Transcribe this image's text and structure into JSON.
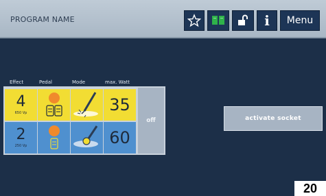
{
  "header": {
    "program_name": "PROGRAM NAME",
    "info_label": "i",
    "menu_label": "Menu",
    "icons": [
      "star-icon",
      "book-icon",
      "unlock-icon",
      "info-icon"
    ]
  },
  "columns": {
    "effect": "Effect",
    "pedal": "Pedal",
    "mode": "Mode",
    "max_watt": "max. Watt"
  },
  "channels": [
    {
      "effect": "4",
      "effect_sub": "650 Vp",
      "pedal_icon": "double-pedal-icon",
      "mode_icon": "cut-instrument-icon",
      "max_watt": "35",
      "color": "#f2dd33"
    },
    {
      "effect": "2",
      "effect_sub": "250 Vp",
      "pedal_icon": "single-pedal-icon",
      "mode_icon": "coag-instrument-icon",
      "max_watt": "60",
      "color": "#4f90cf"
    }
  ],
  "off_label": "off",
  "activate_label": "activate socket",
  "page_number": "20",
  "colors": {
    "header": "#bfcbd6",
    "background": "#1c2f48",
    "cut": "#f2dd33",
    "coag": "#4f90cf",
    "button": "#1d3556"
  }
}
